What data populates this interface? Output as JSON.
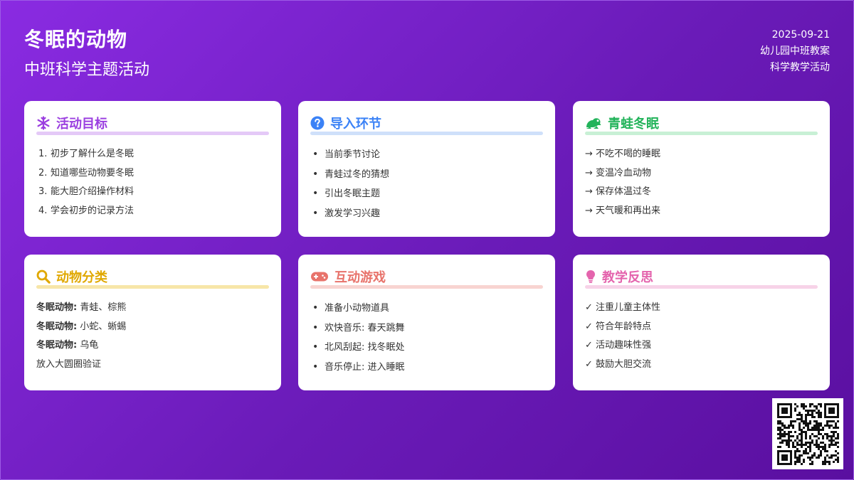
{
  "header": {
    "title": "冬眠的动物",
    "subtitle": "中班科学主题活动",
    "date": "2025-09-21",
    "meta_line1": "幼儿园中班教案",
    "meta_line2": "科学教学活动"
  },
  "cards": [
    {
      "title": "活动目标",
      "icon": "snowflake-icon",
      "color": "#9b3fe0",
      "underline": "#e4c9f7",
      "items": [
        {
          "marker": "1.",
          "text": "初步了解什么是冬眠"
        },
        {
          "marker": "2.",
          "text": "知道哪些动物要冬眠"
        },
        {
          "marker": "3.",
          "text": "能大胆介绍操作材料"
        },
        {
          "marker": "4.",
          "text": "学会初步的记录方法"
        }
      ]
    },
    {
      "title": "导入环节",
      "icon": "question-circle-icon",
      "color": "#3b82f6",
      "underline": "#cfe0fa",
      "items": [
        "当前季节讨论",
        "青蛙过冬的猜想",
        "引出冬眠主题",
        "激发学习兴趣"
      ]
    },
    {
      "title": "青蛙冬眠",
      "icon": "frog-icon",
      "color": "#22b35a",
      "underline": "#c8f0d5",
      "items": [
        "→ 不吃不喝的睡眠",
        "→ 变温冷血动物",
        "→ 保存体温过冬",
        "→ 天气暖和再出来"
      ]
    },
    {
      "title": "动物分类",
      "icon": "search-icon",
      "color": "#e0a800",
      "underline": "#f7e6a8",
      "items": [
        {
          "label": "冬眠动物:",
          "text": " 青蛙、棕熊"
        },
        {
          "label": "冬眠动物:",
          "text": " 小蛇、蜥蜴"
        },
        {
          "label": "冬眠动物:",
          "text": " 乌龟"
        },
        {
          "label": "",
          "text": "放入大圆圈验证"
        }
      ]
    },
    {
      "title": "互动游戏",
      "icon": "gamepad-icon",
      "color": "#e8736b",
      "underline": "#f8d4d1",
      "items": [
        "准备小动物道具",
        "欢快音乐: 春天跳舞",
        "北风刮起: 找冬眠处",
        "音乐停止: 进入睡眠"
      ]
    },
    {
      "title": "教学反思",
      "icon": "lightbulb-icon",
      "color": "#e464ad",
      "underline": "#f7d3e8",
      "items": [
        "✓ 注重儿童主体性",
        "✓ 符合年龄特点",
        "✓ 活动趣味性强",
        "✓ 鼓励大胆交流"
      ]
    }
  ]
}
